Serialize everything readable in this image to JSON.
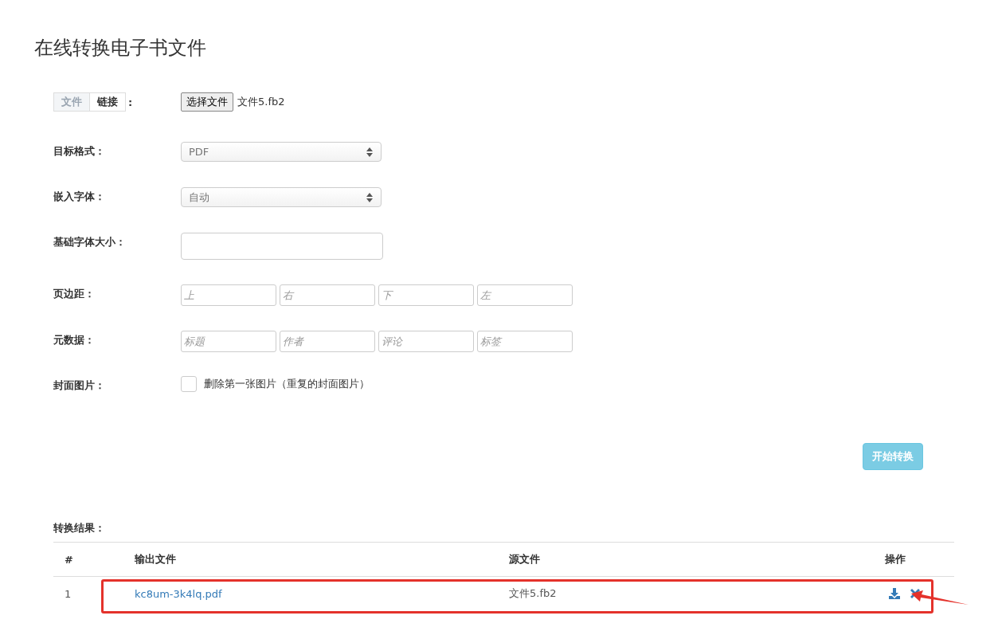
{
  "title": "在线转换电子书文件",
  "source_toggle": {
    "options": [
      {
        "label": "文件",
        "selected": true
      },
      {
        "label": "链接",
        "selected": false
      }
    ],
    "colon": ":"
  },
  "file_input": {
    "button": "选择文件",
    "file_name": "文件5.fb2"
  },
  "fields": [
    {
      "kind": "select",
      "label": "目标格式：",
      "value": "PDF"
    },
    {
      "kind": "select",
      "label": "嵌入字体：",
      "value": "自动"
    },
    {
      "kind": "text",
      "label": "基础字体大小："
    },
    {
      "kind": "multi",
      "label": "页边距：",
      "placeholders": [
        "上",
        "右",
        "下",
        "左"
      ]
    },
    {
      "kind": "multi",
      "label": "元数据：",
      "placeholders": [
        "标题",
        "作者",
        "评论",
        "标签"
      ]
    },
    {
      "kind": "checkbox",
      "label": "封面图片：",
      "text": "删除第一张图片（重复的封面图片）",
      "checked": false
    }
  ],
  "submit": "开始转换",
  "results": {
    "label": "转换结果：",
    "columns": [
      "#",
      "输出文件",
      "源文件",
      "操作"
    ],
    "rows": [
      {
        "index": "1",
        "output": "kc8um-3k4lq.pdf",
        "source": "文件5.fb2"
      }
    ]
  }
}
